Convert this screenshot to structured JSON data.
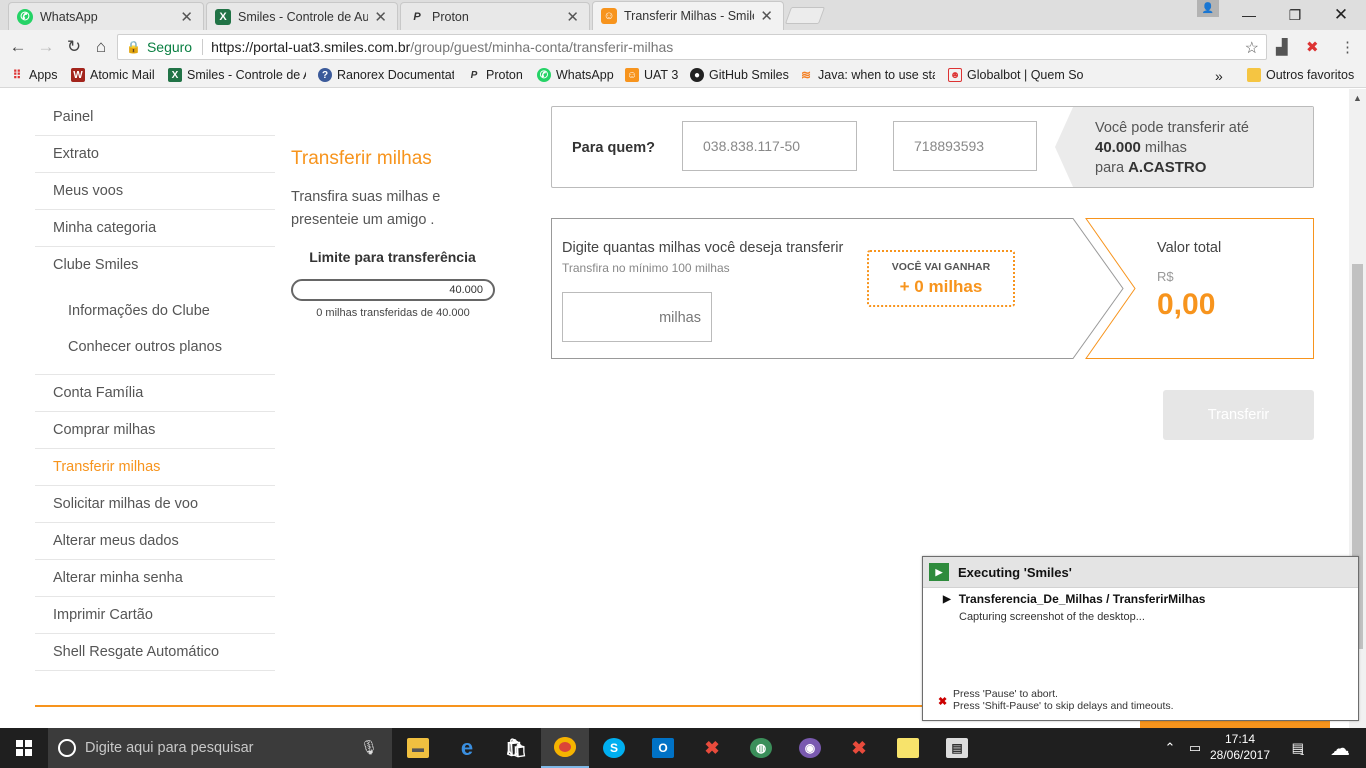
{
  "browser": {
    "tabs": [
      {
        "title": "WhatsApp",
        "icon": "whatsapp-icon",
        "active": false
      },
      {
        "title": "Smiles - Controle de Aut",
        "icon": "excel-icon",
        "active": false
      },
      {
        "title": "Proton",
        "icon": "proton-icon",
        "active": false
      },
      {
        "title": "Transferir Milhas - Smiles",
        "icon": "smiles-icon",
        "active": true
      }
    ],
    "secure_label": "Seguro",
    "url_host": "https://portal-uat3.smiles.com.br",
    "url_path": "/group/guest/minha-conta/transferir-milhas",
    "bookmarks": [
      {
        "label": "Apps",
        "icon": "apps-grid-icon"
      },
      {
        "label": "Atomic Mail",
        "icon": "atomic-mail-icon"
      },
      {
        "label": "Smiles - Controle de A",
        "icon": "excel-icon"
      },
      {
        "label": "Ranorex Documentati",
        "icon": "ranorex-icon"
      },
      {
        "label": "Proton",
        "icon": "proton-icon"
      },
      {
        "label": "WhatsApp",
        "icon": "whatsapp-icon"
      },
      {
        "label": "UAT 3",
        "icon": "smiles-icon"
      },
      {
        "label": "GitHub Smiles",
        "icon": "github-icon"
      },
      {
        "label": "Java: when to use stat",
        "icon": "stackoverflow-icon"
      },
      {
        "label": "Globalbot | Quem Sor",
        "icon": "globalbot-icon"
      }
    ],
    "more_bookmarks": "»",
    "other_bookmarks": "Outros favoritos"
  },
  "sidebar": {
    "items": [
      {
        "label": "Painel"
      },
      {
        "label": "Extrato"
      },
      {
        "label": "Meus voos"
      },
      {
        "label": "Minha categoria"
      },
      {
        "label": "Clube Smiles"
      }
    ],
    "sub_items": [
      {
        "label": "Informações do Clube"
      },
      {
        "label": "Conhecer outros planos"
      }
    ],
    "items2": [
      {
        "label": "Conta Família"
      },
      {
        "label": "Comprar milhas"
      },
      {
        "label": "Transferir milhas",
        "active": true
      },
      {
        "label": "Solicitar milhas de voo"
      },
      {
        "label": "Alterar meus dados"
      },
      {
        "label": "Alterar minha senha"
      },
      {
        "label": "Imprimir Cartão"
      },
      {
        "label": "Shell Resgate Automático"
      }
    ]
  },
  "main": {
    "title": "Transferir milhas",
    "description": "Transfira suas milhas e presenteie um amigo .",
    "limit_title": "Limite para transferência",
    "limit_value": "40.000",
    "limit_fill": 0,
    "limit_sub": "0 milhas transferidas de 40.000"
  },
  "recipient": {
    "label": "Para quem?",
    "cpf_value": "038.838.117-50",
    "number_value": "718893593",
    "info_prefix": "Você pode transferir até",
    "info_amount": "40.000",
    "info_unit": "milhas",
    "info_to": "para",
    "info_name": "A.CASTRO"
  },
  "amount": {
    "title": "Digite quantas milhas você deseja transferir",
    "subtitle": "Transfira no mínimo 100 milhas",
    "input_suffix": "milhas",
    "gain_label": "VOCÊ VAI GANHAR",
    "gain_value": "+ 0 milhas",
    "total_label": "Valor total",
    "total_currency": "R$",
    "total_value": "0,00"
  },
  "transfer_button": "Transferir",
  "ranorex": {
    "title": "Executing 'Smiles'",
    "step": "Transferencia_De_Milhas / TransferirMilhas",
    "status": "Capturing screenshot of the desktop...",
    "hint1": "Press 'Pause' to abort.",
    "hint2": "Press 'Shift-Pause' to skip delays and timeouts."
  },
  "taskbar": {
    "search_placeholder": "Digite aqui para pesquisar",
    "time": "17:14",
    "date": "28/06/2017",
    "notification_count": "1"
  },
  "colors": {
    "accent": "#f7941d",
    "chrome_tab_bar": "#dedede",
    "taskbar": "#1f1f1f"
  }
}
